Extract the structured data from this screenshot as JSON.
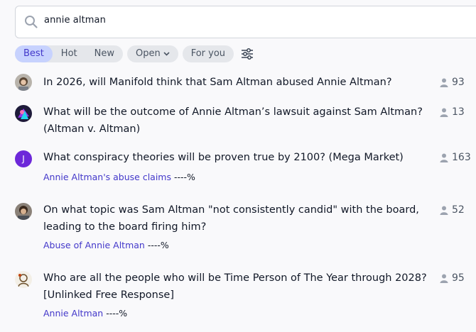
{
  "search": {
    "value": "annie altman"
  },
  "sort_tabs": [
    {
      "label": "Best",
      "active": true
    },
    {
      "label": "Hot",
      "active": false
    },
    {
      "label": "New",
      "active": false
    }
  ],
  "filters": {
    "status": "Open",
    "feed": "For you"
  },
  "colors": {
    "accent": "#4338ca",
    "active_tab_bg": "#c7d2fe",
    "pill_bg": "#e5e7eb",
    "background": "#f9f9fb"
  },
  "results": [
    {
      "question": "In 2026, will Manifold think that Sam Altman abused Annie Altman?",
      "traders": "93",
      "avatar_icon": "user-photo-icon"
    },
    {
      "question": "What will be the outcome of Annie Altman’s lawsuit against Sam Altman? (Altman v. Altman)",
      "traders": "13",
      "avatar_icon": "user-art-icon"
    },
    {
      "question": "What conspiracy theories will be proven true by 2100? (Mega Market)",
      "traders": "163",
      "avatar_letter": "J",
      "avatar_color": "#6d28d9",
      "answer": "Annie Altman's abuse claims",
      "answer_pct": "----%"
    },
    {
      "question": "On what topic was Sam Altman \"not consistently candid\" with the board, leading to the board firing him?",
      "traders": "52",
      "avatar_icon": "user-photo-icon",
      "answer": "Abuse of Annie Altman",
      "answer_pct": "----%"
    },
    {
      "question": "Who are all the people who will be Time Person of The Year through 2028? [Unlinked Free Response]",
      "traders": "95",
      "avatar_icon": "user-drawing-icon",
      "answer": "Annie Altman",
      "answer_pct": "----%"
    }
  ]
}
